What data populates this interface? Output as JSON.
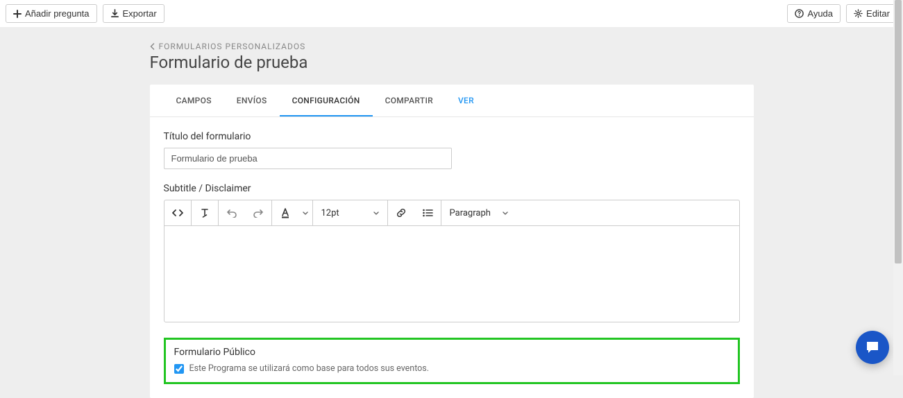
{
  "toolbar": {
    "add_question": "Añadir pregunta",
    "export": "Exportar",
    "help": "Ayuda",
    "edit": "Editar"
  },
  "breadcrumb": {
    "label": "FORMULARIOS PERSONALIZADOS"
  },
  "page": {
    "title": "Formulario de prueba"
  },
  "tabs": {
    "campos": "CAMPOS",
    "envios": "ENVÍOS",
    "configuracion": "CONFIGURACIÓN",
    "compartir": "COMPARTIR",
    "ver": "VER"
  },
  "form": {
    "title_label": "Título del formulario",
    "title_value": "Formulario de prueba",
    "subtitle_label": "Subtitle / Disclaimer",
    "editor": {
      "fontsize": "12pt",
      "blocktype": "Paragraph"
    },
    "public_title": "Formulario Público",
    "public_checkbox_label": "Este Programa se utilizará como base para todos sus eventos.",
    "public_checked": true
  }
}
